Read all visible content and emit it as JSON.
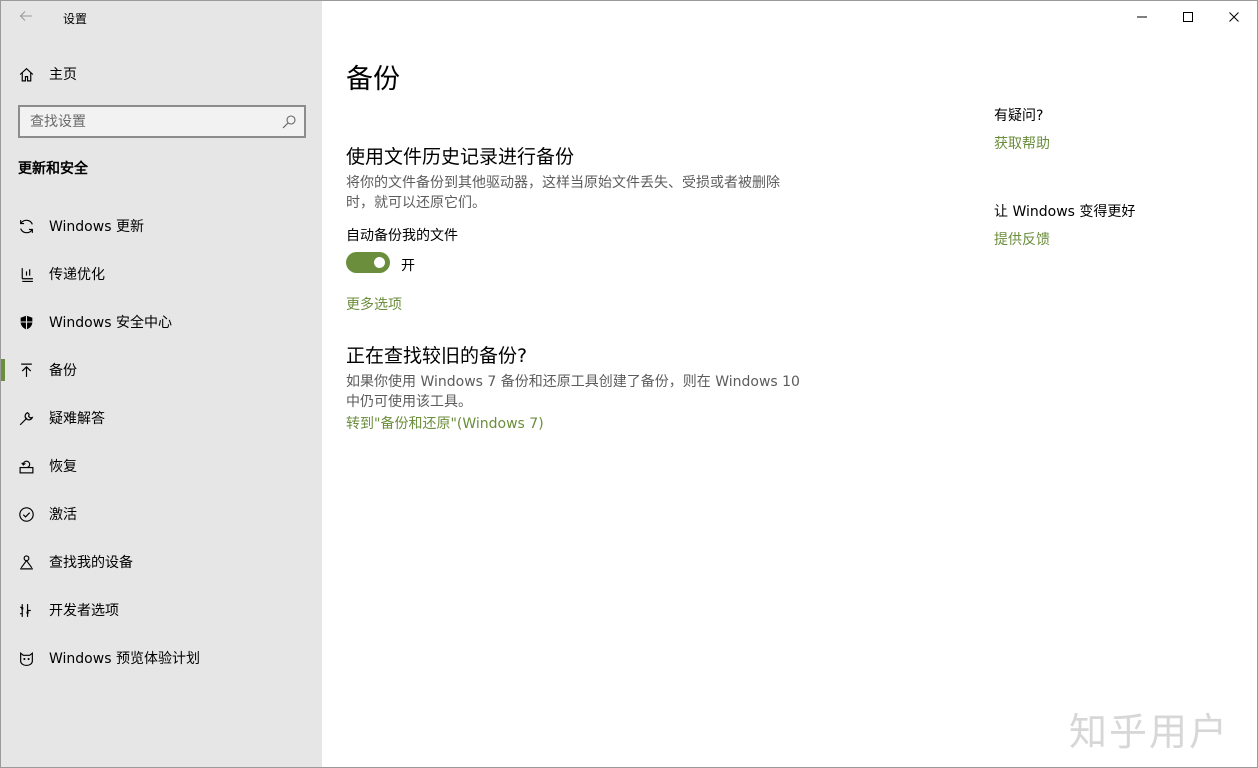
{
  "window": {
    "title": "设置",
    "controls": [
      "minimize-icon",
      "maximize-icon",
      "close-icon"
    ]
  },
  "sidebar": {
    "home_label": "主页",
    "search_placeholder": "查找设置",
    "section_heading": "更新和安全",
    "items": [
      {
        "label": "Windows 更新",
        "icon": "sync-icon"
      },
      {
        "label": "传递优化",
        "icon": "delivery-icon"
      },
      {
        "label": "Windows 安全中心",
        "icon": "shield-icon"
      },
      {
        "label": "备份",
        "icon": "backup-arrow-icon",
        "selected": true
      },
      {
        "label": "疑难解答",
        "icon": "wrench-icon"
      },
      {
        "label": "恢复",
        "icon": "recovery-icon"
      },
      {
        "label": "激活",
        "icon": "check-circle-icon"
      },
      {
        "label": "查找我的设备",
        "icon": "find-device-icon"
      },
      {
        "label": "开发者选项",
        "icon": "developer-icon"
      },
      {
        "label": "Windows 预览体验计划",
        "icon": "insider-cat-icon"
      }
    ]
  },
  "main": {
    "page_title": "备份",
    "file_history": {
      "heading": "使用文件历史记录进行备份",
      "description": "将你的文件备份到其他驱动器，这样当原始文件丢失、受损或者被删除时，就可以还原它们。",
      "toggle_label": "自动备份我的文件",
      "toggle_state": "开",
      "toggle_on": true,
      "more_options": "更多选项"
    },
    "older_backup": {
      "heading": "正在查找较旧的备份?",
      "description": "如果你使用 Windows 7 备份和还原工具创建了备份，则在 Windows 10 中仍可使用该工具。",
      "link": "转到\"备份和还原\"(Windows 7)"
    }
  },
  "side_panel": {
    "question_title": "有疑问?",
    "help_link": "获取帮助",
    "improve_title": "让 Windows 变得更好",
    "feedback_link": "提供反馈"
  },
  "watermark": "知乎用户",
  "colors": {
    "accent": "#6b8e3c",
    "sidebar_bg": "#e6e6e6",
    "description_text": "#5c5c5c"
  }
}
